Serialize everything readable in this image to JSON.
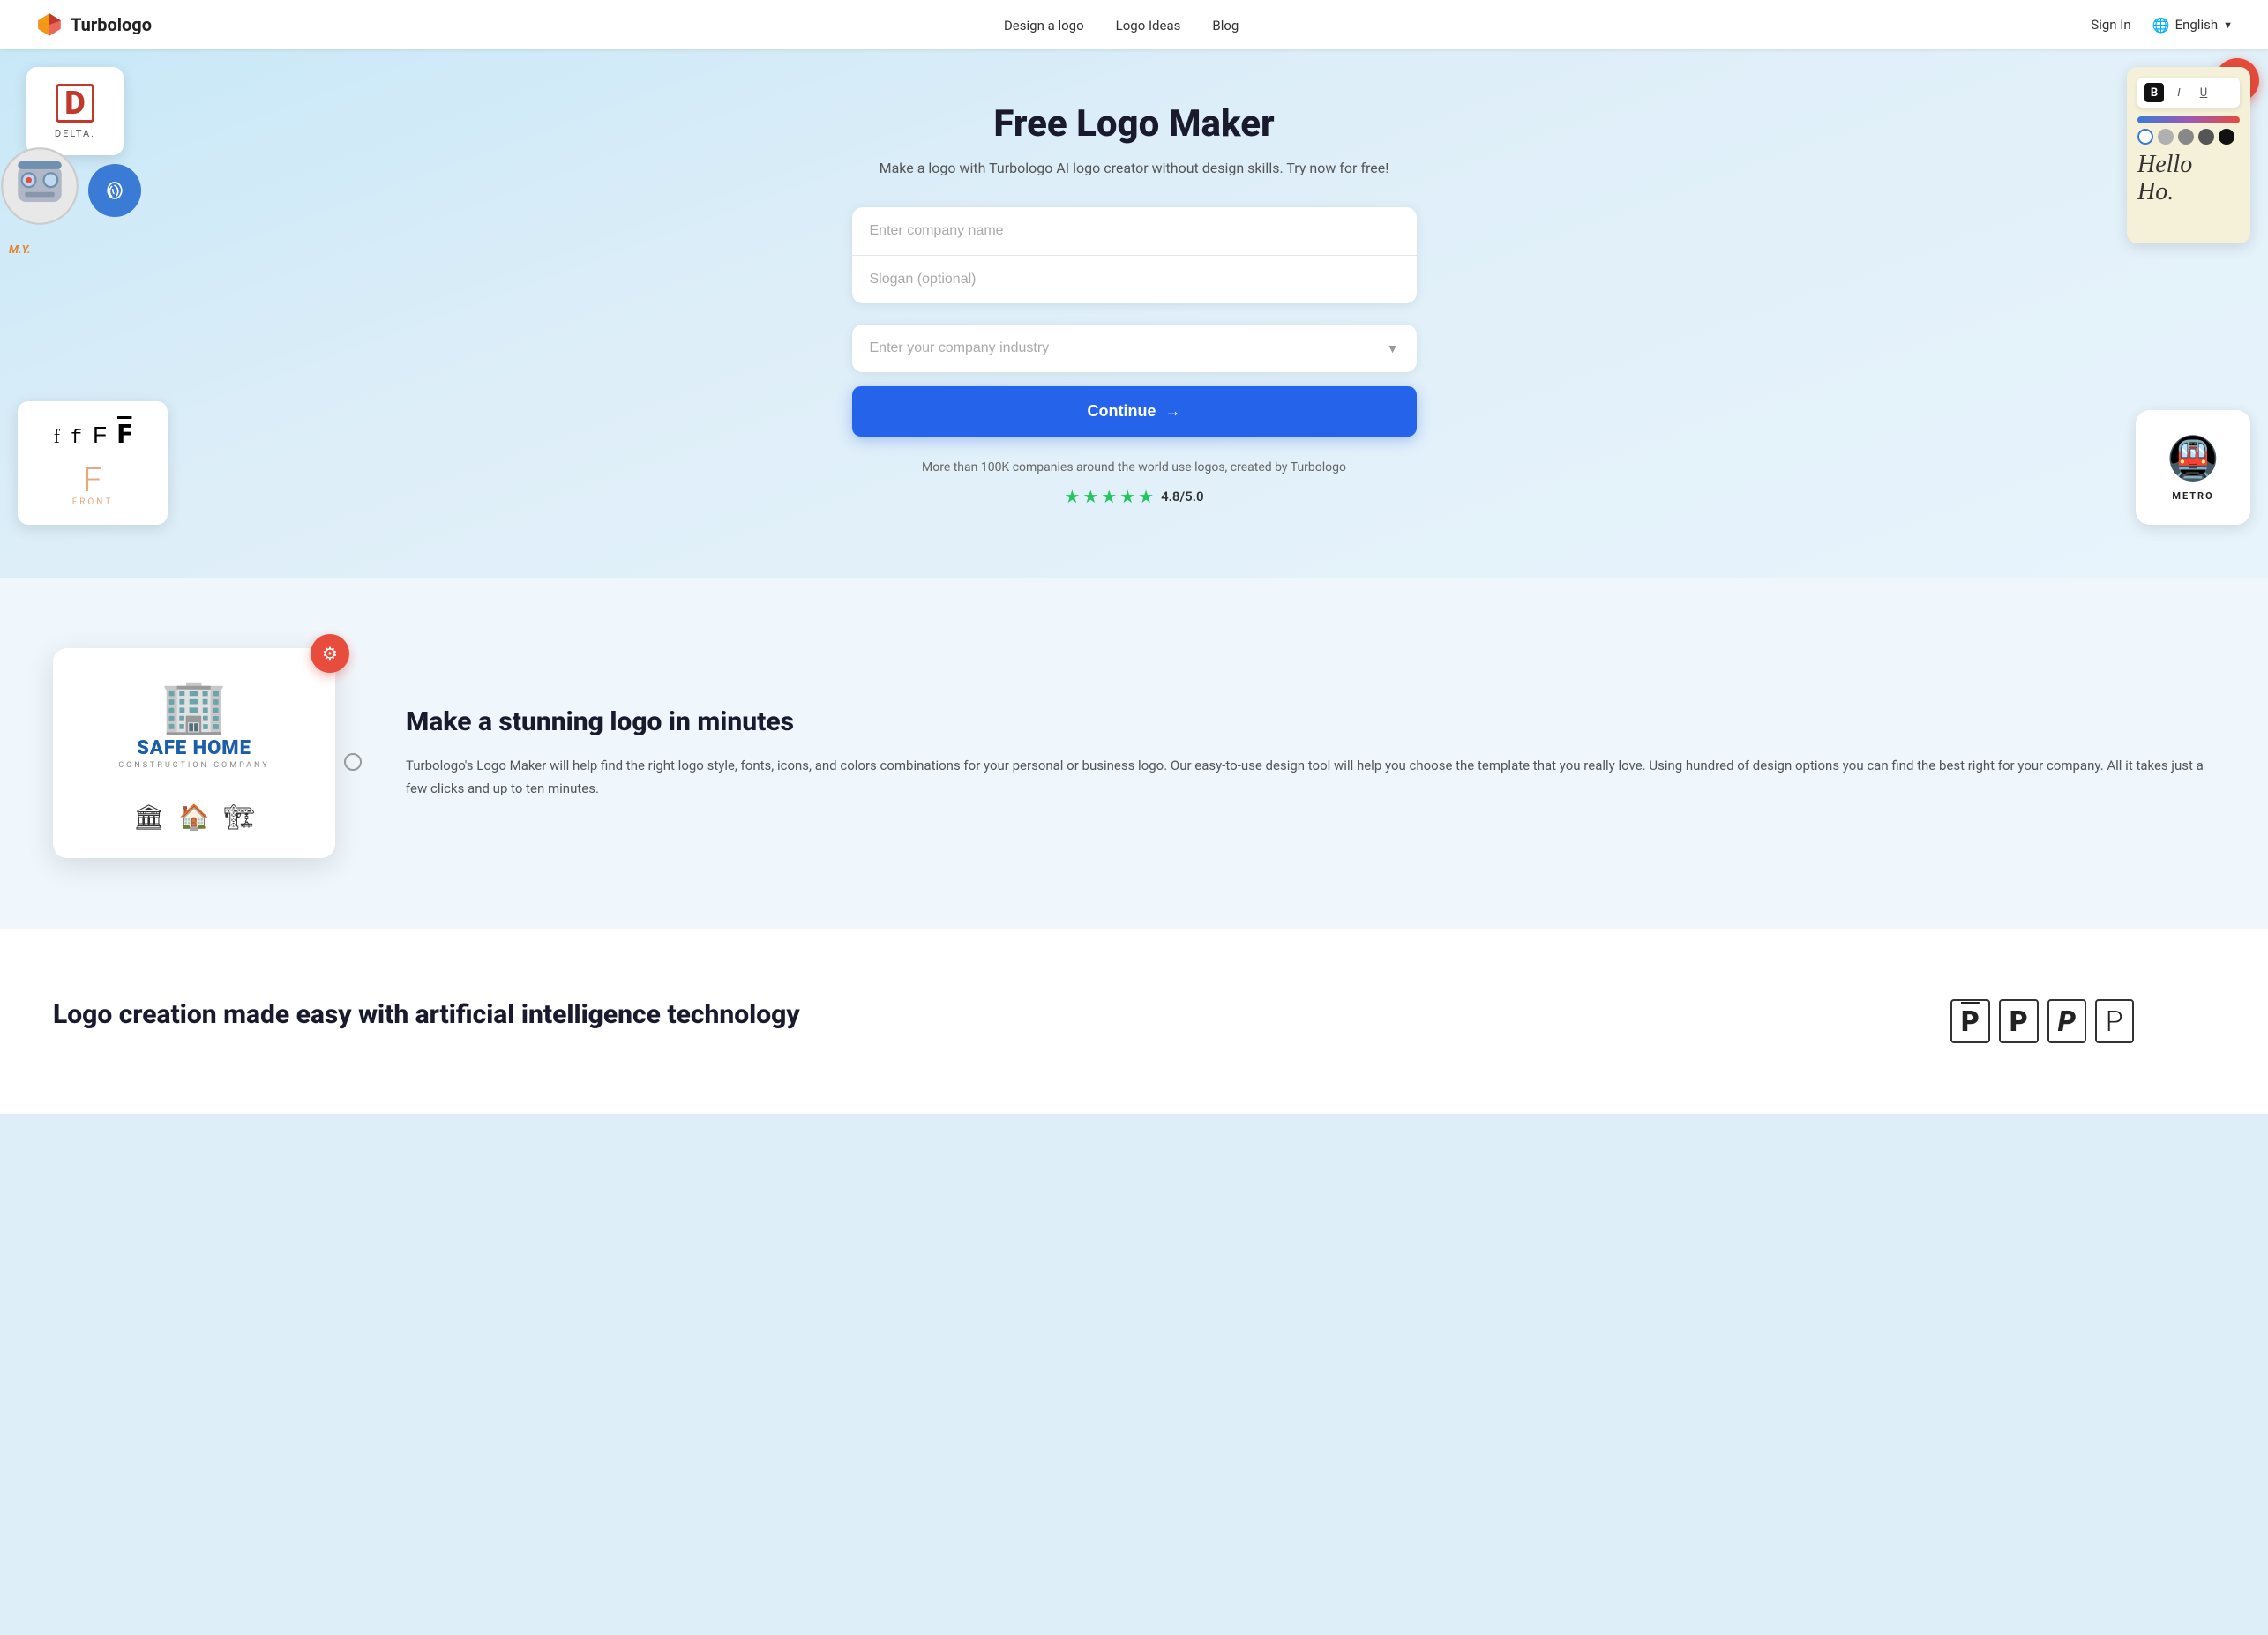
{
  "nav": {
    "logo_text": "Turbologo",
    "links": [
      {
        "label": "Design a logo",
        "href": "#"
      },
      {
        "label": "Logo Ideas",
        "href": "#"
      },
      {
        "label": "Blog",
        "href": "#"
      }
    ],
    "sign_in": "Sign In",
    "language": "English"
  },
  "hero": {
    "title": "Free Logo Maker",
    "subtitle": "Make a logo with Turbologo AI logo creator without design skills. Try now for free!",
    "company_name_placeholder": "Enter company name",
    "slogan_placeholder": "Slogan (optional)",
    "industry_placeholder": "Enter your company industry",
    "continue_button": "Continue",
    "trust_text": "More than 100K companies around the world use logos, created by Turbologo",
    "rating": "4.8/5.0",
    "stars_count": 5
  },
  "section2": {
    "title": "Make a stunning logo in minutes",
    "description": "Turbologo's Logo Maker will help find the right logo style, fonts, icons, and colors combinations for your personal or business logo. Our easy-to-use design tool will help you choose the template that you really love. Using hundred of design options you can find the best right for your company. All it takes just a few clicks and up to ten minutes.",
    "mockup": {
      "company_name": "SAFE HOME",
      "company_sub": "CONSTRUCTION COMPANY"
    }
  },
  "section3": {
    "title": "Logo creation made easy with artificial intelligence technology"
  },
  "deco": {
    "delta_letter": "D",
    "delta_label": "DELTA.",
    "front_label": "FRONT",
    "metro_label": "METRO",
    "hello_text": "Hello Ho.",
    "fonts_label": "f f F F"
  }
}
